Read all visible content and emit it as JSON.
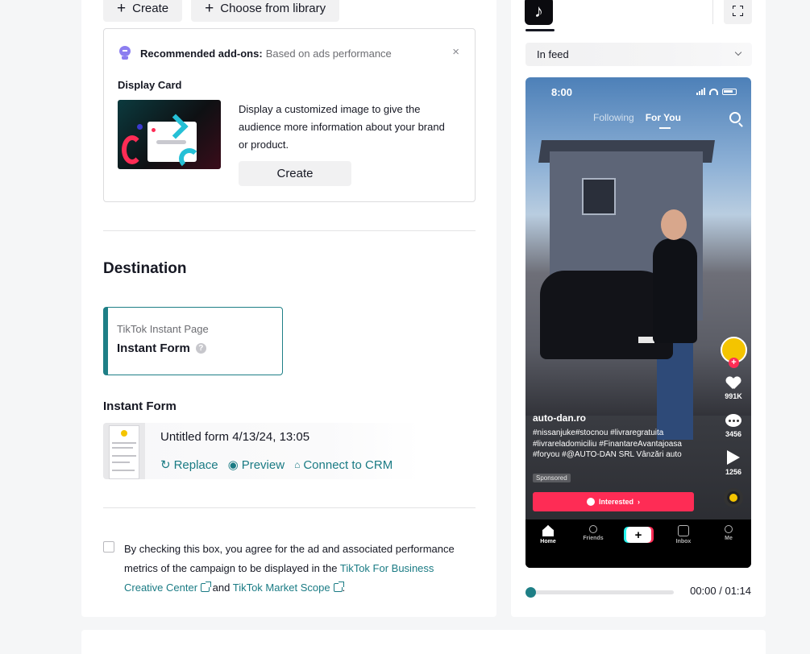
{
  "toolbar": {
    "create_label": "Create",
    "choose_label": "Choose from library"
  },
  "recommended": {
    "title": "Recommended add-ons:",
    "subtitle": "Based on ads performance",
    "close": "×",
    "card_title": "Display Card",
    "card_description": "Display a customized image to give the audience more information about your brand or product.",
    "create_label": "Create"
  },
  "destination": {
    "title": "Destination",
    "caption": "TikTok Instant Page",
    "value": "Instant Form",
    "help": "?"
  },
  "instant_form": {
    "title": "Instant Form",
    "name": "Untitled form 4/13/24, 13:05",
    "replace": "Replace",
    "preview": "Preview",
    "connect": "Connect to CRM"
  },
  "agreement": {
    "text_before": "By checking this box, you agree for the ad and associated performance metrics of the campaign to be displayed in the ",
    "link1": "TikTok For Business Creative Center",
    "and": " and ",
    "link2": "TikTok Market Scope",
    "period": "."
  },
  "preview": {
    "placement": "In feed",
    "status_time": "8:00",
    "tab_following": "Following",
    "tab_foryou": "For You",
    "likes": "991K",
    "comments": "3456",
    "shares": "1256",
    "username": "auto-dan.ro",
    "caption": "#nissanjuke#stocnou #livraregratuita #livrareladomiciliu #FinantareAvantajoasa #foryou #@AUTO-DAN SRL Vânzări auto",
    "sponsored": "Sponsored",
    "cta": "Interested",
    "nav": {
      "home": "Home",
      "friends": "Friends",
      "inbox": "Inbox",
      "me": "Me"
    },
    "progress": 0,
    "time": "00:00 / 01:14"
  },
  "colors": {
    "accent": "#1e7f86",
    "tiktok_red": "#fe2c55",
    "tiktok_cyan": "#25f4ee"
  }
}
